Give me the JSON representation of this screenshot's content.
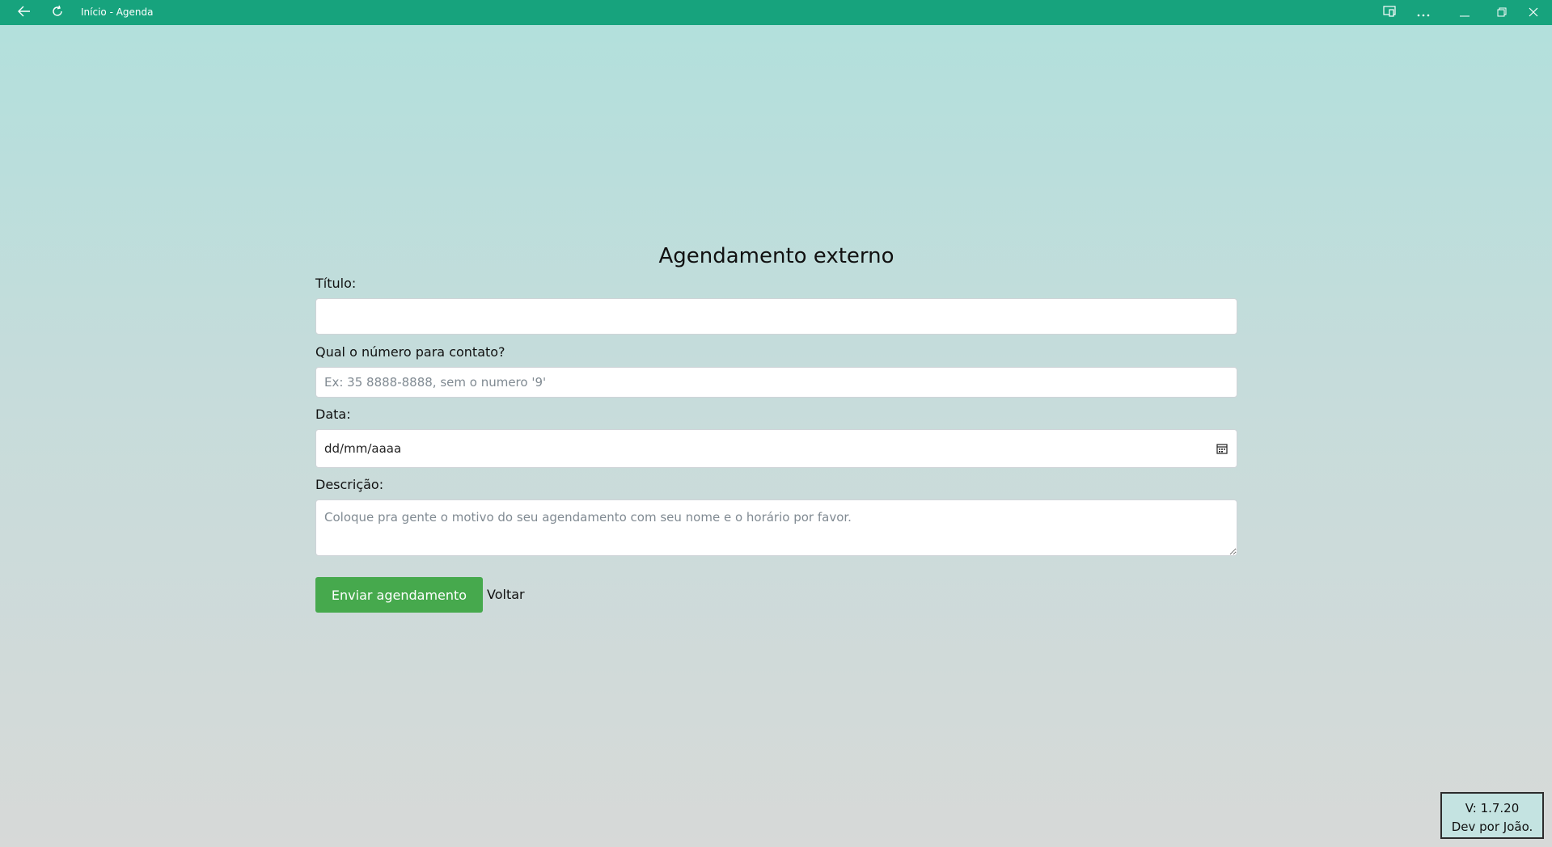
{
  "window": {
    "title": "Início - Agenda",
    "back_icon": "arrow-left-icon",
    "refresh_icon": "refresh-icon",
    "cast_icon": "cast-icon",
    "more_icon": "more-icon",
    "minimize_icon": "minimize-icon",
    "restore_icon": "restore-icon",
    "close_icon": "close-icon",
    "accent_color": "#17a37d"
  },
  "form": {
    "heading": "Agendamento externo",
    "title_label": "Título:",
    "title_value": "",
    "phone_label": "Qual o número para contato?",
    "phone_placeholder": "Ex: 35 8888-8888, sem o numero '9'",
    "date_label": "Data:",
    "date_value": "dd/mm/aaaa",
    "description_label": "Descrição:",
    "description_placeholder": "Coloque pra gente o motivo do seu agendamento com seu nome e o horário por favor.",
    "submit_label": "Enviar agendamento",
    "back_label": "Voltar",
    "submit_color": "#46a94d"
  },
  "footer": {
    "version": "V: 1.7.20",
    "credit": "Dev por João."
  }
}
